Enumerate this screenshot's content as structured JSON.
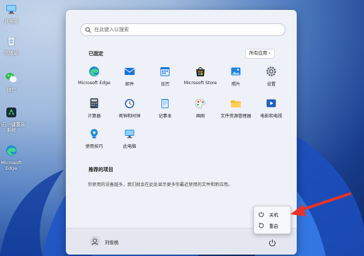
{
  "desktop": {
    "icons": [
      {
        "label": "此电脑",
        "icon": "computer-icon"
      },
      {
        "label": "回收站",
        "icon": "recycle-bin-icon"
      },
      {
        "label": "微信",
        "icon": "wechat-icon"
      },
      {
        "label": "小白一键重装系统",
        "icon": "reinstall-icon"
      },
      {
        "label": "Microsoft Edge",
        "icon": "edge-icon"
      }
    ]
  },
  "start_menu": {
    "search_placeholder": "在此键入以搜索",
    "pinned_title": "已固定",
    "all_apps_label": "所有应用 ›",
    "pinned_apps": [
      {
        "label": "Microsoft Edge",
        "icon": "edge-icon"
      },
      {
        "label": "邮件",
        "icon": "mail-icon"
      },
      {
        "label": "日历",
        "icon": "calendar-icon"
      },
      {
        "label": "Microsoft Store",
        "icon": "store-icon"
      },
      {
        "label": "照片",
        "icon": "photos-icon"
      },
      {
        "label": "设置",
        "icon": "settings-icon"
      },
      {
        "label": "计算器",
        "icon": "calculator-icon"
      },
      {
        "label": "闹钟和时钟",
        "icon": "clock-icon"
      },
      {
        "label": "记事本",
        "icon": "notepad-icon"
      },
      {
        "label": "画图",
        "icon": "paint-icon"
      },
      {
        "label": "文件资源管理器",
        "icon": "file-explorer-icon"
      },
      {
        "label": "电影和电视",
        "icon": "movies-icon"
      },
      {
        "label": "使用技巧",
        "icon": "tips-icon"
      },
      {
        "label": "此电脑",
        "icon": "computer-icon"
      }
    ],
    "recommended_title": "推荐的项目",
    "recommended_text": "你使用的设备越多，我们就会在此处显示更多你最近使用的文件和新应用。",
    "user_name": "刘俊桃"
  },
  "power_menu": {
    "items": [
      {
        "label": "关机",
        "icon": "power-icon"
      },
      {
        "label": "重启",
        "icon": "restart-icon"
      }
    ]
  },
  "colors": {
    "annotation_arrow": "#e8332a",
    "menu_background": "#eef1f7",
    "desktop_blue": "#1a3f8f"
  }
}
